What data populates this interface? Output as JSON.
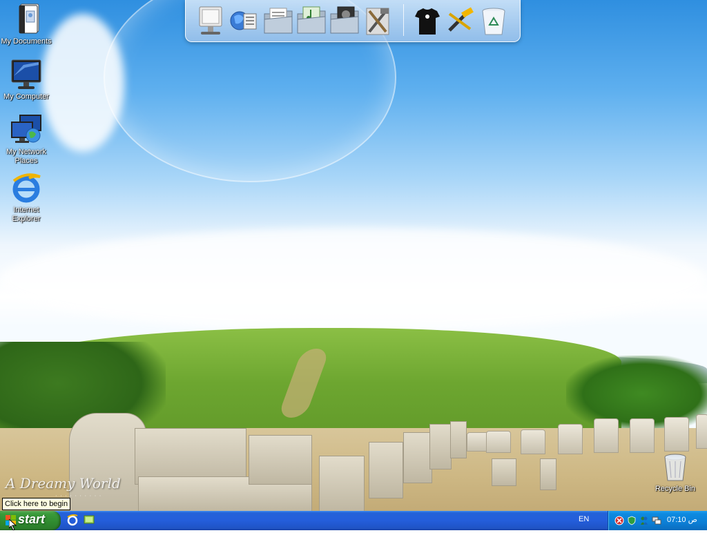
{
  "desktop": {
    "icons": [
      {
        "label": "My Documents",
        "icon": "my-documents-icon"
      },
      {
        "label": "My Computer",
        "icon": "my-computer-icon"
      },
      {
        "label": "My Network Places",
        "icon": "network-places-icon"
      },
      {
        "label": "Internet Explorer",
        "icon": "internet-explorer-icon"
      }
    ],
    "recycle_bin": {
      "label": "Recycle Bin",
      "icon": "recycle-bin-icon"
    },
    "wallpaper_text": "A Dreamy World"
  },
  "dock": {
    "items": [
      "computer-icon",
      "network-icon",
      "documents-folder-icon",
      "music-folder-icon",
      "pictures-folder-icon",
      "tools-icon",
      "shirt-icon",
      "hammer-tools-icon",
      "recycle-bin-icon"
    ]
  },
  "tooltip": {
    "text": "Click here to begin"
  },
  "taskbar": {
    "start_label": "start",
    "quick_launch": [
      "internet-explorer-icon",
      "show-desktop-icon"
    ],
    "language": "EN",
    "tray_icons": [
      "security-alert-icon",
      "shield-icon",
      "messenger-icon",
      "network-icon"
    ],
    "clock": "07:10 ص"
  },
  "colors": {
    "taskbar_blue": "#245edb",
    "start_green": "#3a9b3a",
    "tray_blue": "#0c7fd6",
    "tooltip_bg": "#ffffe1"
  }
}
